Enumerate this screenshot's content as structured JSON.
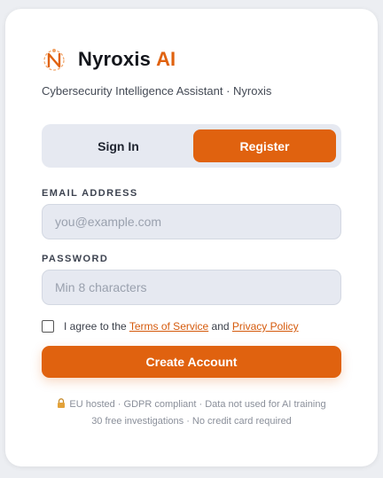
{
  "brand": {
    "name": "Nyroxis",
    "accent": "AI",
    "logo_icon": "n-logo-icon",
    "accent_color": "#e0620f"
  },
  "subtitle": "Cybersecurity Intelligence Assistant · Nyroxis",
  "tabs": [
    {
      "label": "Sign In",
      "active": false
    },
    {
      "label": "Register",
      "active": true
    }
  ],
  "email": {
    "label": "EMAIL ADDRESS",
    "placeholder": "you@example.com",
    "value": ""
  },
  "password": {
    "label": "PASSWORD",
    "placeholder": "Min 8 characters",
    "value": ""
  },
  "agree": {
    "checked": false,
    "prefix": "I agree to the",
    "terms_label": "Terms of Service",
    "and": "and",
    "privacy_label": "Privacy Policy"
  },
  "submit_label": "Create Account",
  "footer": {
    "line1": "EU hosted · GDPR compliant · Data not used for AI training",
    "line2": "30 free investigations · No credit card required",
    "lock_icon": "lock-icon"
  }
}
